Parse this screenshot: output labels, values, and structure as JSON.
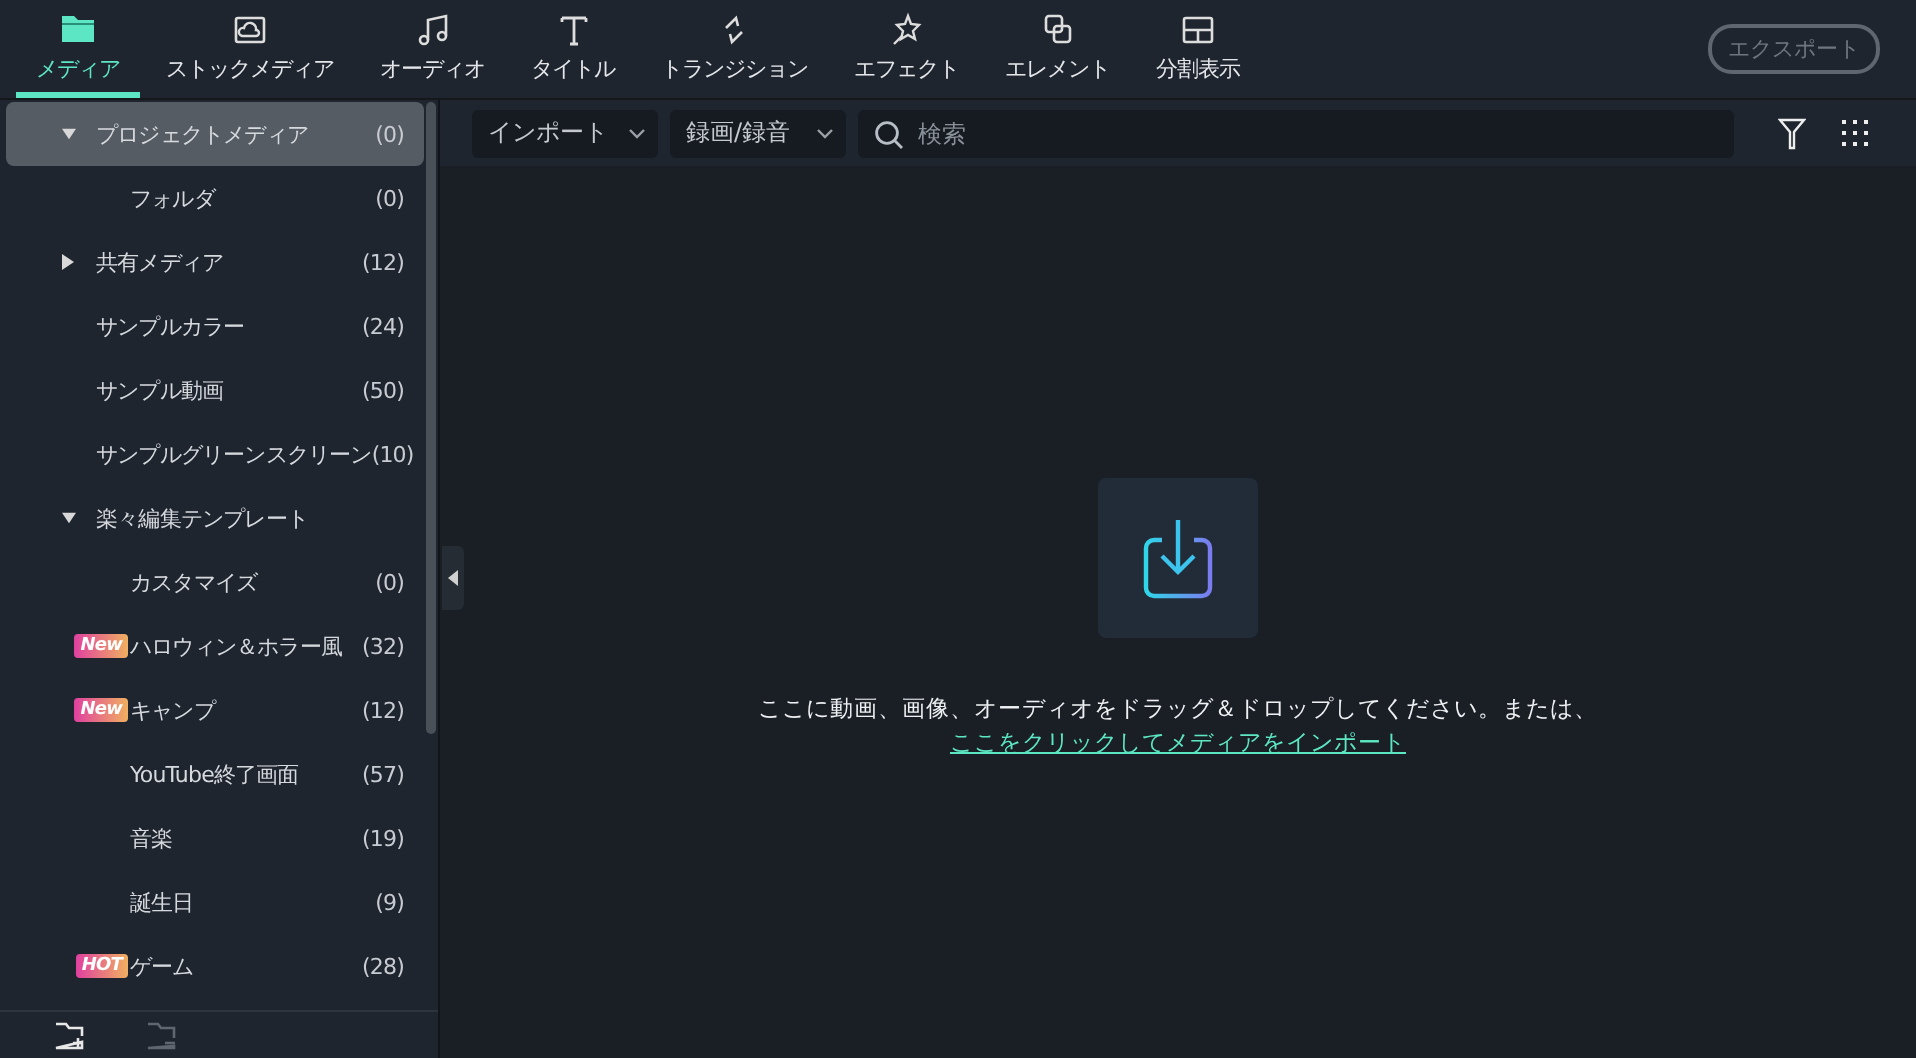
{
  "toolbar": {
    "tabs": [
      {
        "label": "メディア",
        "selected": true
      },
      {
        "label": "ストックメディア",
        "selected": false
      },
      {
        "label": "オーディオ",
        "selected": false
      },
      {
        "label": "タイトル",
        "selected": false
      },
      {
        "label": "トランジション",
        "selected": false
      },
      {
        "label": "エフェクト",
        "selected": false
      },
      {
        "label": "エレメント",
        "selected": false
      },
      {
        "label": "分割表示",
        "selected": false
      }
    ],
    "export_button": {
      "label": "エクスポート",
      "disabled": true
    }
  },
  "sidebar": {
    "items": [
      {
        "label": "プロジェクトメディア",
        "count": "(0)",
        "expanded": true,
        "selected": true,
        "children": [
          {
            "label": "フォルダ",
            "count": "(0)",
            "selected": false
          }
        ]
      },
      {
        "label": "共有メディア",
        "count": "(12)",
        "expanded": false,
        "selected": false
      },
      {
        "label": "サンプルカラー",
        "count": "(24)",
        "selected": false
      },
      {
        "label": "サンプル動画",
        "count": "(50)",
        "selected": false
      },
      {
        "label": "サンプルグリーンスクリーン",
        "count": "(10)",
        "selected": false
      },
      {
        "label": "楽々編集テンプレート",
        "expanded": true,
        "selected": false,
        "children": [
          {
            "label": "カスタマイズ",
            "count": "(0)",
            "selected": false
          },
          {
            "label": "ハロウィン＆ホラー風",
            "count": "(32)",
            "badge": "New",
            "selected": false
          },
          {
            "label": "キャンプ",
            "count": "(12)",
            "badge": "New",
            "selected": false
          },
          {
            "label": "YouTube終了画面",
            "count": "(57)",
            "selected": false
          },
          {
            "label": "音楽",
            "count": "(19)",
            "selected": false
          },
          {
            "label": "誕生日",
            "count": "(9)",
            "selected": false
          },
          {
            "label": "ゲーム",
            "count": "(28)",
            "badge": "HOT",
            "selected": false
          }
        ]
      }
    ]
  },
  "media_bar": {
    "import_dropdown": "インポート",
    "record_dropdown": "録画/録音",
    "search": {
      "placeholder": "検索"
    }
  },
  "drop_zone": {
    "message": "ここに動画、画像、オーディオをドラッグ＆ドロップしてください。または、",
    "link": "ここをクリックしてメディアをインポート"
  }
}
